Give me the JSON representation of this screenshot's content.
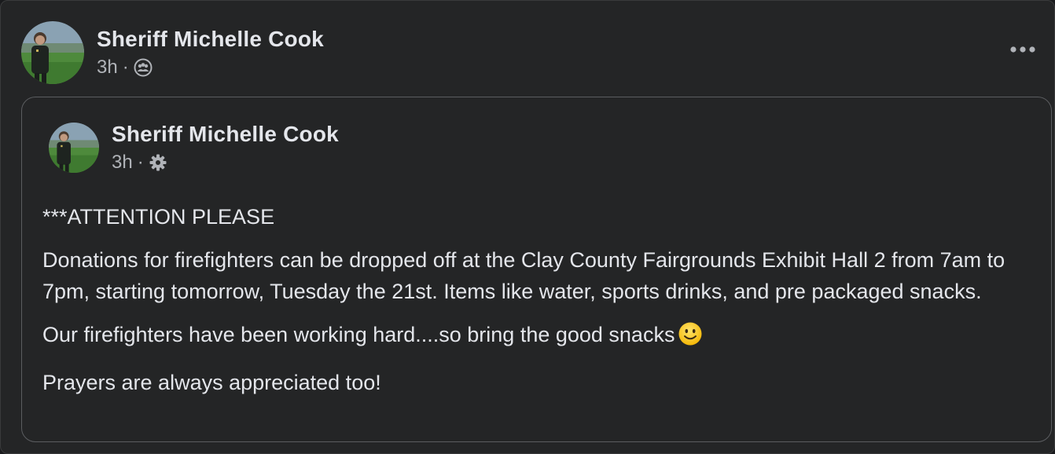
{
  "post": {
    "author": "Sheriff Michelle Cook",
    "time": "3h",
    "separator": "·",
    "audience_icon": "friends-group-icon",
    "more_icon": "ellipsis-horizontal-icon"
  },
  "shared_post": {
    "author": "Sheriff Michelle Cook",
    "time": "3h",
    "separator": "·",
    "audience_icon": "gear-icon",
    "lines": [
      "***ATTENTION PLEASE",
      "Donations for firefighters can be dropped off at the Clay County Fairgrounds Exhibit Hall 2 from 7am to 7pm, starting tomorrow, Tuesday the 21st.   Items like water, sports drinks, and pre packaged snacks.",
      "Our firefighters have been working hard....so bring the good snacks",
      "Prayers are always appreciated too!"
    ],
    "emoji": "slightly-smiling-face-emoji"
  },
  "colors": {
    "card_bg": "#242526",
    "text_primary": "#e4e6eb",
    "text_secondary": "#b0b3b8",
    "inner_border": "#5b5d60"
  }
}
